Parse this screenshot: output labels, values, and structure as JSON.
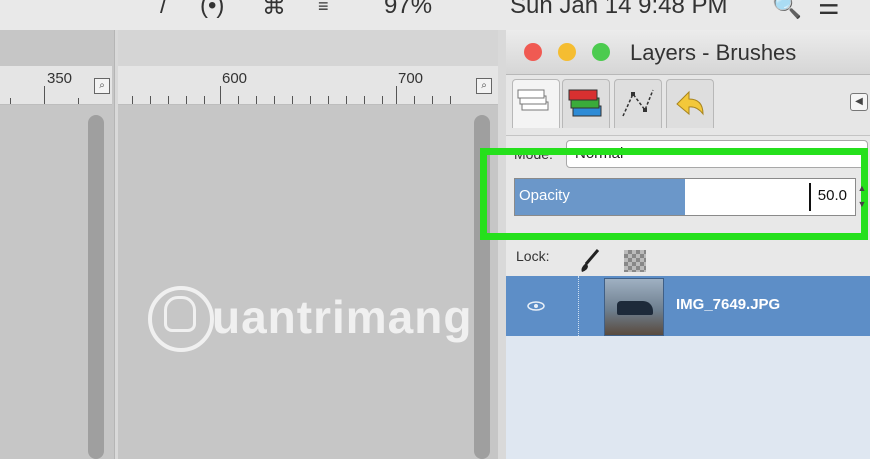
{
  "menubar": {
    "items": [
      "(•)",
      "⌘",
      "≡",
      "97%",
      "Sun Jan 14  9:48 PM",
      "🔍",
      "☰"
    ]
  },
  "rulers": {
    "left_labels": [
      "350"
    ],
    "mid_labels": [
      "600",
      "700"
    ]
  },
  "watermark": {
    "text": "uantrimang"
  },
  "panel": {
    "title": "Layers - Brushes",
    "mode_label": "Mode:",
    "mode_value": "Normal",
    "opacity_label": "Opacity",
    "opacity_value": "50.0",
    "opacity_fraction": 0.5,
    "lock_label": "Lock:",
    "layer": {
      "name": "IMG_7649.JPG",
      "visible_icon": "eye-icon"
    }
  },
  "colors": {
    "highlight": "#25e01c",
    "selection": "#5d8ec7",
    "opacity_fill": "#6b97c9",
    "traffic_red": "#f05a52",
    "traffic_yellow": "#f5bd31",
    "traffic_green": "#4ccb4f"
  },
  "icons": [
    "layers-icon",
    "channels-icon",
    "paths-icon",
    "undo-history-icon",
    "paintbrush-icon",
    "checkerboard-icon",
    "zoom-icon"
  ]
}
